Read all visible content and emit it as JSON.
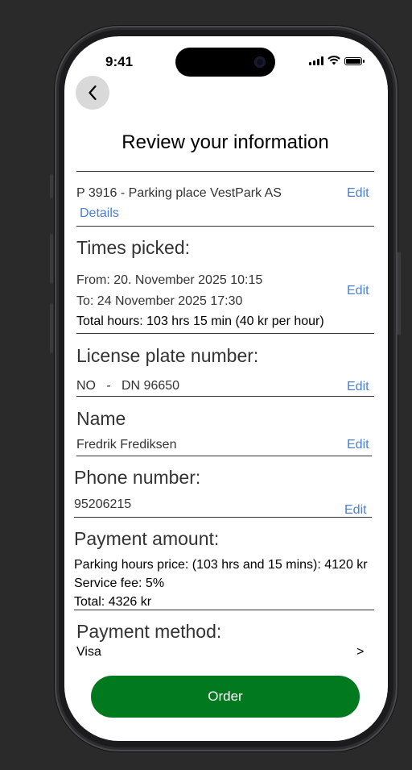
{
  "status_bar": {
    "time": "9:41"
  },
  "header": {
    "title": "Review your information"
  },
  "parking": {
    "summary": "P 3916  -  Parking place VestPark AS",
    "edit_label": "Edit",
    "details_label": "Details"
  },
  "times": {
    "heading": "Times picked:",
    "from": "From: 20. November 2025 10:15",
    "to": "To: 24 November 2025 17:30",
    "total": "Total hours: 103 hrs 15 min (40 kr per hour)",
    "edit_label": "Edit"
  },
  "license": {
    "heading": "License plate number:",
    "value": "NO   -   DN 96650",
    "edit_label": "Edit"
  },
  "name": {
    "heading": "Name",
    "value": "Fredrik Frediksen",
    "edit_label": "Edit"
  },
  "phone": {
    "heading": "Phone number:",
    "value": "95206215",
    "edit_label": "Edit"
  },
  "payment_amount": {
    "heading": "Payment amount:",
    "hours_price": "Parking hours price: (103 hrs and 15 mins): 4120 kr",
    "service_fee": "Service fee: 5%",
    "total": "Total: 4326 kr"
  },
  "payment_method": {
    "heading": "Payment method:",
    "value": "Visa",
    "chevron": ">"
  },
  "order_button": {
    "label": "Order"
  },
  "colors": {
    "accent_green": "#017a1f",
    "link_blue": "#4a7fd2"
  }
}
